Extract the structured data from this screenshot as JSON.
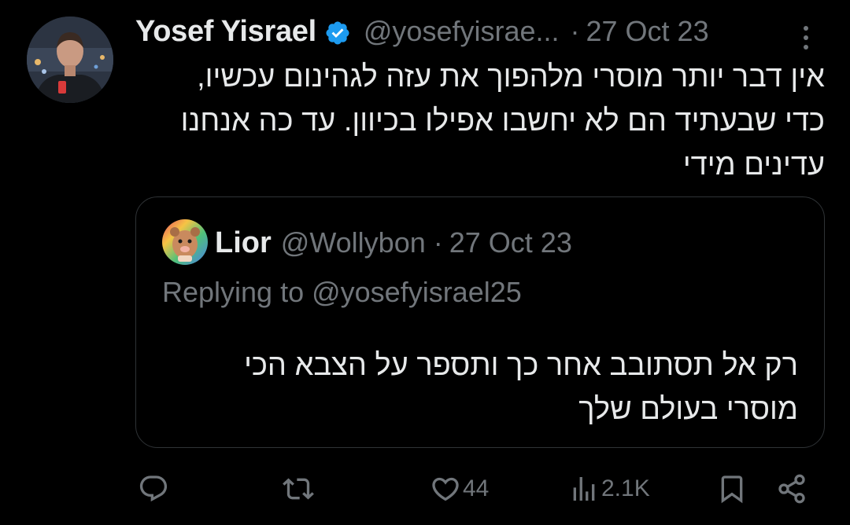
{
  "tweet": {
    "author": {
      "display_name": "Yosef Yisrael",
      "handle": "@yosefyisrae...",
      "verified": true,
      "avatar_icon": "profile-photo"
    },
    "date": "27 Oct 23",
    "separator": "·",
    "body_lines": [
      "אין דבר יותר מוסרי מלהפוך את עזה לגהינום עכשיו,",
      "כדי שבעתיד הם לא יחשבו אפילו בכיוון. עד כה אנחנו",
      "עדינים מידי"
    ],
    "quote": {
      "author": {
        "display_name": "Lior",
        "handle": "@Wollybon",
        "avatar_icon": "cartoon-avatar"
      },
      "date": "27 Oct 23",
      "separator": "·",
      "replying_prefix": "Replying to ",
      "replying_to": "@yosefyisrael25",
      "body_lines": [
        "רק אל תסתובב אחר כך ותספר על הצבא הכי",
        "מוסרי בעולם שלך"
      ]
    },
    "actions": {
      "reply": {
        "icon": "reply-icon",
        "count": ""
      },
      "retweet": {
        "icon": "retweet-icon",
        "count": ""
      },
      "like": {
        "icon": "heart-icon",
        "count": "44"
      },
      "views": {
        "icon": "views-icon",
        "count": "2.1K"
      },
      "bookmark": {
        "icon": "bookmark-icon",
        "count": ""
      },
      "share": {
        "icon": "share-icon",
        "count": ""
      }
    }
  },
  "colors": {
    "background": "#000000",
    "text_primary": "#e7e9ea",
    "text_secondary": "#71767b",
    "border": "#2f3336",
    "verified_blue": "#1d9bf0"
  }
}
